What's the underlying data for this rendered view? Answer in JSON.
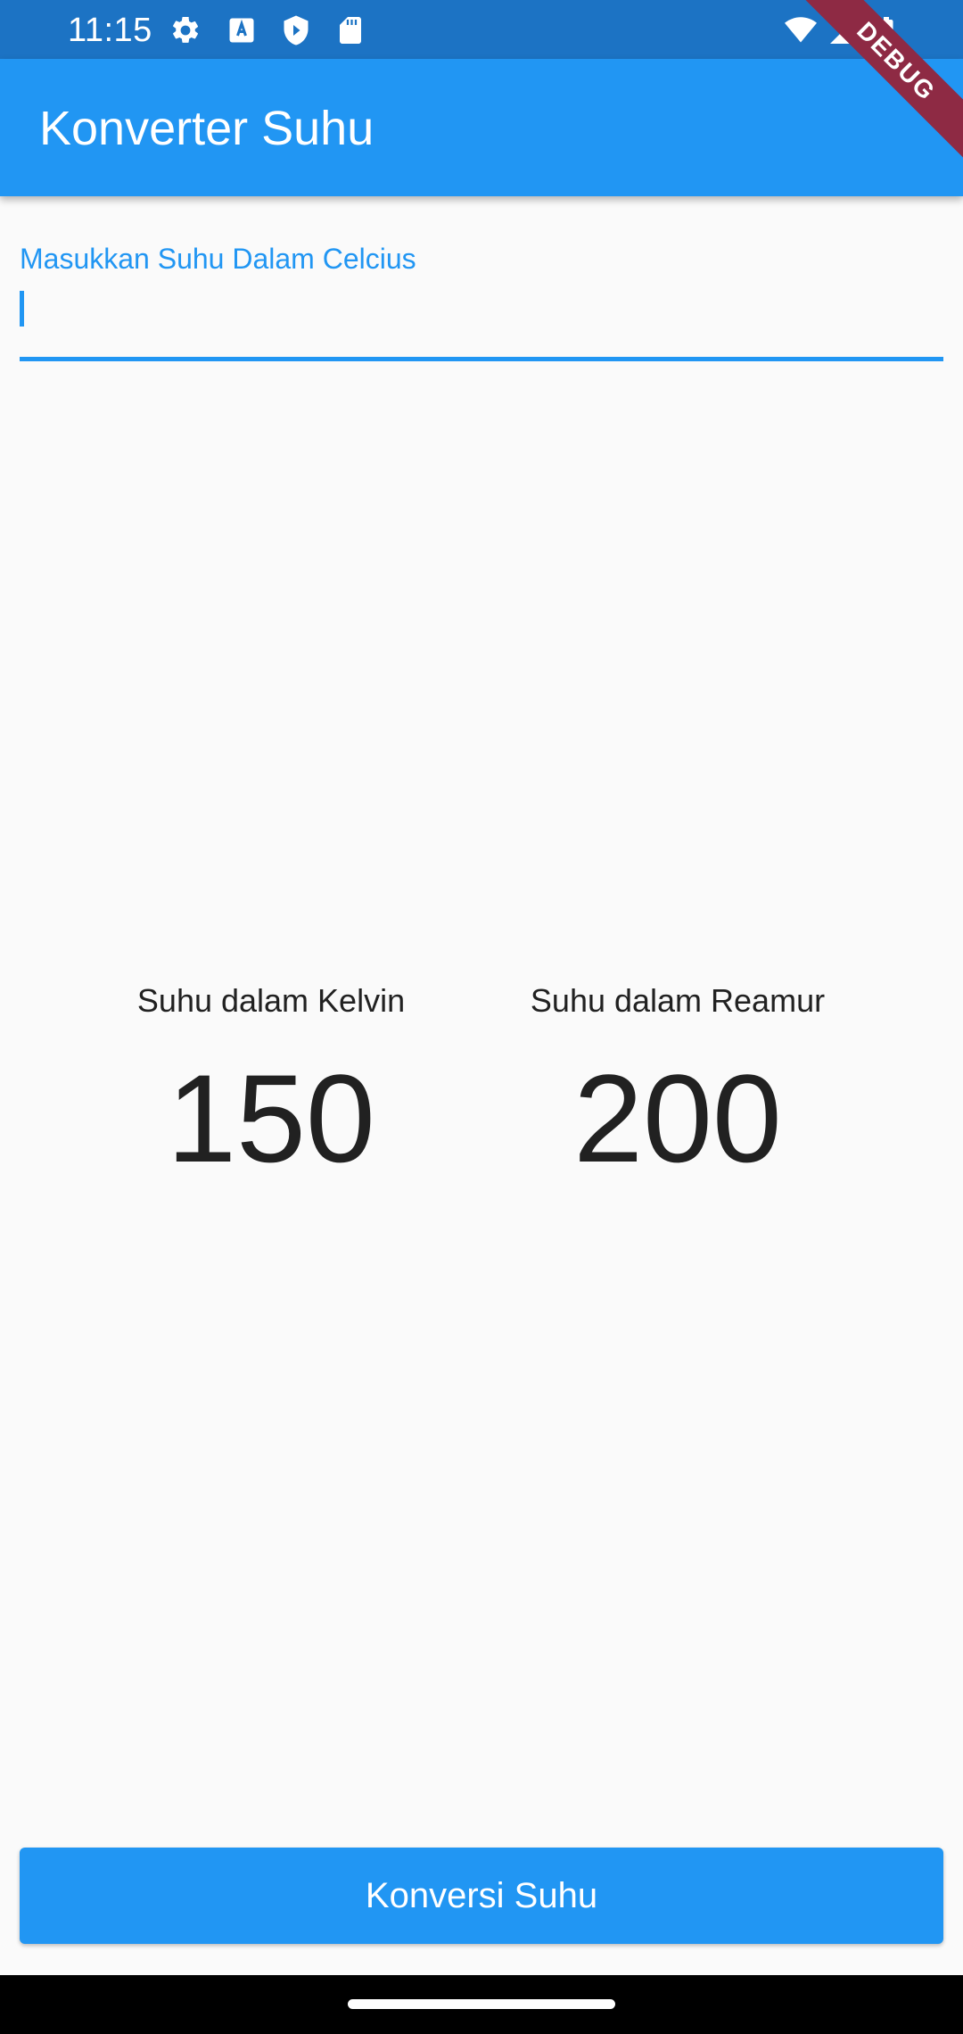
{
  "status_bar": {
    "time": "11:15",
    "icons": [
      "gear-icon",
      "a-icon",
      "shield-icon",
      "sd-card-icon",
      "wifi-icon",
      "signal-icon",
      "battery-icon"
    ]
  },
  "app_bar": {
    "title": "Konverter Suhu"
  },
  "debug_banner": {
    "label": "DEBUG"
  },
  "input": {
    "label": "Masukkan Suhu Dalam Celcius",
    "value": ""
  },
  "results": {
    "kelvin": {
      "label": "Suhu dalam Kelvin",
      "value": "150"
    },
    "reamur": {
      "label": "Suhu dalam Reamur",
      "value": "200"
    }
  },
  "button": {
    "label": "Konversi Suhu"
  },
  "colors": {
    "primary": "#2196f3",
    "status_bar": "#1c73c4",
    "background": "#fafafa",
    "text": "#212121",
    "debug_banner": "#8e2a44"
  }
}
